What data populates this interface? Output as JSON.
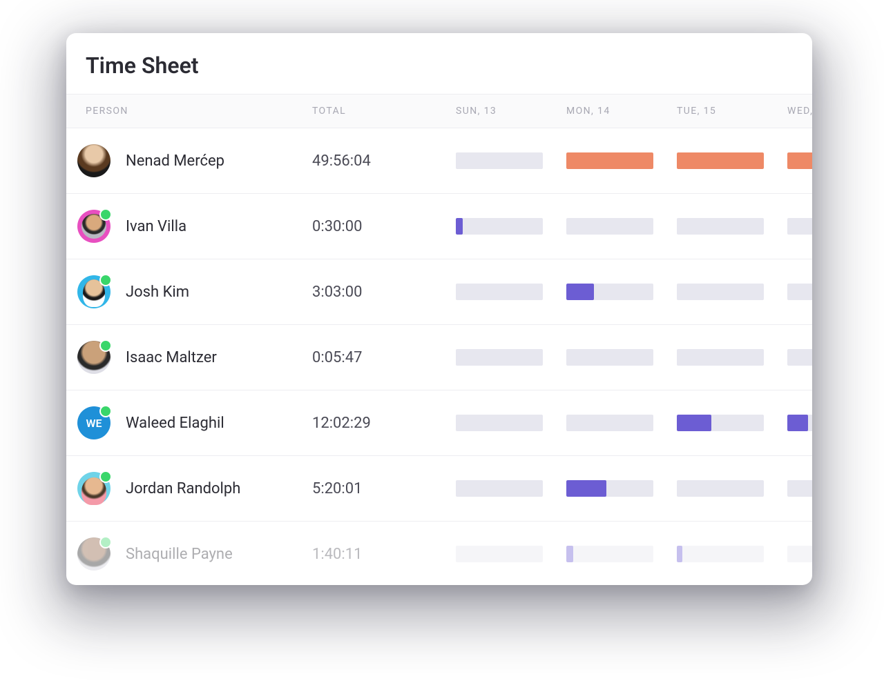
{
  "title": "Time Sheet",
  "columns": {
    "person": "PERSON",
    "total": "TOTAL",
    "days": [
      "SUN, 13",
      "MON, 14",
      "TUE, 15",
      "WED,"
    ]
  },
  "colors": {
    "orange": "#ee8966",
    "purple": "#6c5dd3",
    "track": "#e7e7ef"
  },
  "people": [
    {
      "name": "Nenad Merćep",
      "avatar_class": "av-nenad",
      "avatar_text": "",
      "online": false,
      "total": "49:56:04",
      "bars": [
        {
          "pct": 0,
          "color": "orange"
        },
        {
          "pct": 100,
          "color": "orange"
        },
        {
          "pct": 100,
          "color": "orange"
        },
        {
          "pct": 100,
          "color": "orange"
        }
      ]
    },
    {
      "name": "Ivan Villa",
      "avatar_class": "av-ivan",
      "avatar_text": "",
      "online": true,
      "total": "0:30:00",
      "bars": [
        {
          "pct": 8,
          "color": "purple"
        },
        {
          "pct": 0,
          "color": "purple"
        },
        {
          "pct": 0,
          "color": "purple"
        },
        {
          "pct": 0,
          "color": "purple"
        }
      ]
    },
    {
      "name": "Josh Kim",
      "avatar_class": "av-josh",
      "avatar_text": "",
      "online": true,
      "total": "3:03:00",
      "bars": [
        {
          "pct": 0,
          "color": "purple"
        },
        {
          "pct": 32,
          "color": "purple"
        },
        {
          "pct": 0,
          "color": "purple"
        },
        {
          "pct": 0,
          "color": "purple"
        }
      ]
    },
    {
      "name": "Isaac Maltzer",
      "avatar_class": "av-isaac",
      "avatar_text": "",
      "online": true,
      "total": "0:05:47",
      "bars": [
        {
          "pct": 0,
          "color": "purple"
        },
        {
          "pct": 0,
          "color": "purple"
        },
        {
          "pct": 0,
          "color": "purple"
        },
        {
          "pct": 0,
          "color": "purple"
        }
      ]
    },
    {
      "name": "Waleed Elaghil",
      "avatar_class": "av-we",
      "avatar_text": "WE",
      "online": true,
      "total": "12:02:29",
      "bars": [
        {
          "pct": 0,
          "color": "purple"
        },
        {
          "pct": 0,
          "color": "purple"
        },
        {
          "pct": 40,
          "color": "purple"
        },
        {
          "pct": 24,
          "color": "purple"
        }
      ]
    },
    {
      "name": "Jordan Randolph",
      "avatar_class": "av-jordan",
      "avatar_text": "",
      "online": true,
      "total": "5:20:01",
      "bars": [
        {
          "pct": 0,
          "color": "purple"
        },
        {
          "pct": 46,
          "color": "purple"
        },
        {
          "pct": 0,
          "color": "purple"
        },
        {
          "pct": 0,
          "color": "purple"
        }
      ]
    },
    {
      "name": "Shaquille Payne",
      "avatar_class": "av-shaq",
      "avatar_text": "",
      "online": true,
      "total": "1:40:11",
      "faded": true,
      "bars": [
        {
          "pct": 0,
          "color": "purple"
        },
        {
          "pct": 8,
          "color": "purple"
        },
        {
          "pct": 6,
          "color": "purple"
        },
        {
          "pct": 0,
          "color": "purple"
        }
      ]
    }
  ]
}
